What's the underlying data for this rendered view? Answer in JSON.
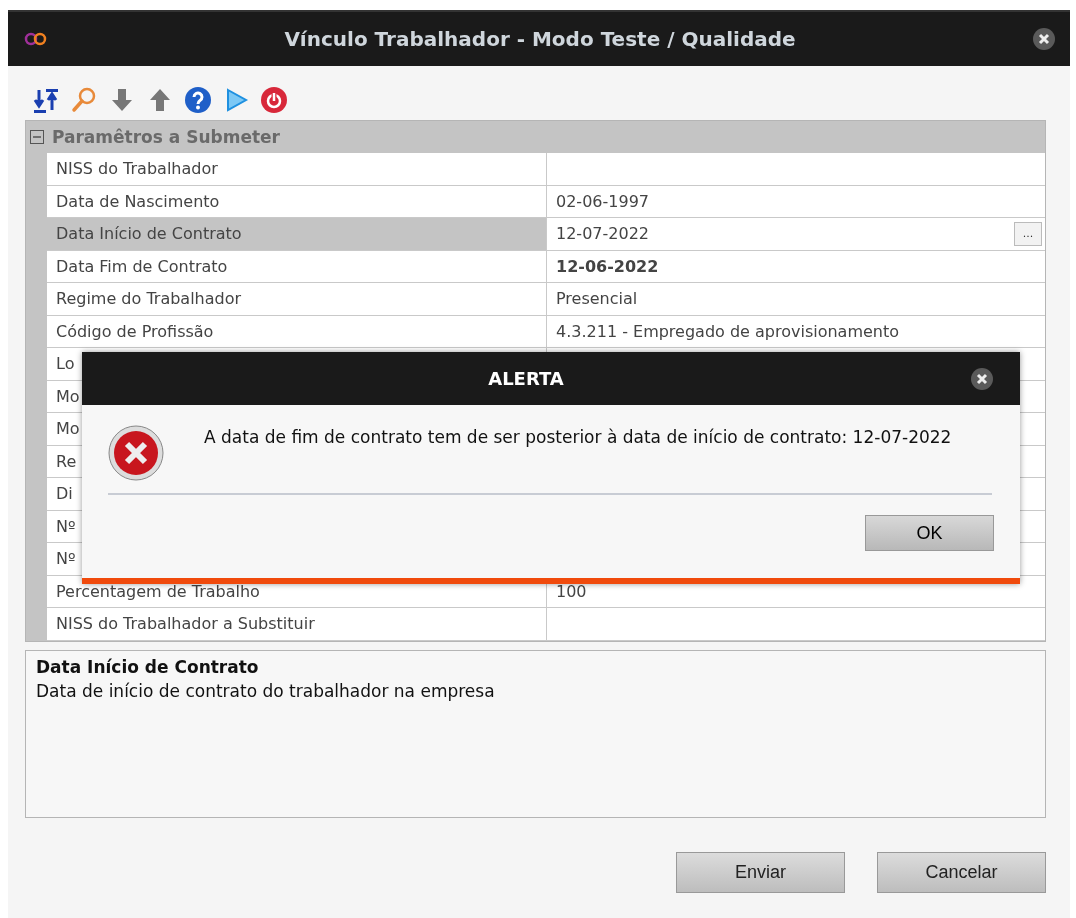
{
  "window": {
    "title": "Vínculo Trabalhador - Modo Teste / Qualidade"
  },
  "grid": {
    "category": {
      "label": "Paramêtros a Submeter",
      "expanded": true
    },
    "rows": [
      {
        "label": "NISS do Trabalhador",
        "selected": false
      },
      {
        "label": "Data de Nascimento",
        "value": "02-06-1997",
        "selected": false,
        "modified": false
      },
      {
        "label": "Data Início de Contrato",
        "value": "12-07-2022",
        "selected": true,
        "modified": false,
        "button": "..."
      },
      {
        "label": "Data Fim de Contrato",
        "value": "12-06-2022",
        "selected": false,
        "modified": true
      },
      {
        "label": "Regime do Trabalhador",
        "value": "Presencial",
        "selected": false,
        "modified": false
      },
      {
        "label": "Código de Profissão",
        "value": "4.3.211 - Empregado de aprovisionamento",
        "selected": false,
        "modified": false
      },
      {
        "label": "Lo",
        "selected": false
      },
      {
        "label": "Mo",
        "selected": false
      },
      {
        "label": "Mo",
        "selected": false
      },
      {
        "label": "Re",
        "selected": false
      },
      {
        "label": "Di",
        "selected": false
      },
      {
        "label": "Nº",
        "selected": false
      },
      {
        "label": "Nº",
        "selected": false
      },
      {
        "label": "Percentagem de Trabalho",
        "value": "100",
        "selected": false,
        "modified": false
      },
      {
        "label": "NISS do Trabalhador a Substituir",
        "selected": false
      }
    ]
  },
  "description": {
    "title": "Data Início de Contrato",
    "text": "Data de início de contrato do trabalhador na empresa"
  },
  "dialog": {
    "title": "ALERTA",
    "message": "A data de fim de contrato tem de ser posterior à data de início de contrato: 12-07-2022",
    "button": "OK"
  },
  "buttons": [
    "Enviar",
    "Cancelar"
  ]
}
